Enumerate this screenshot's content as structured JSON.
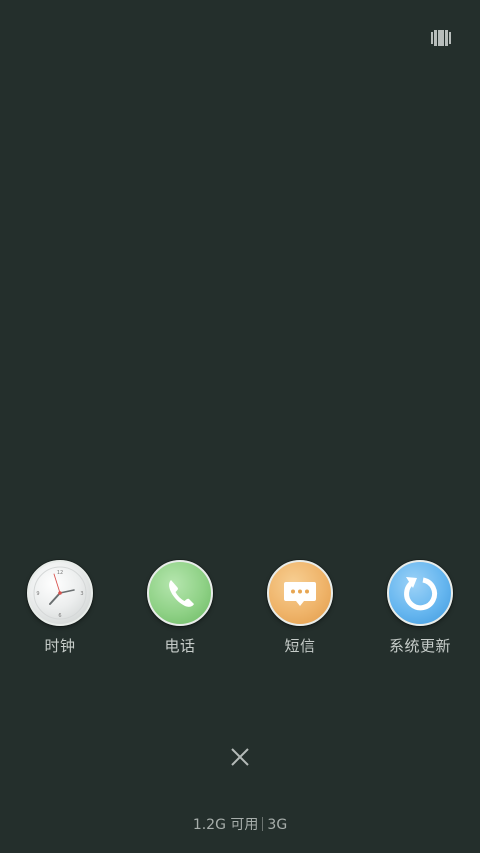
{
  "top_bar": {
    "recent_apps_icon": "recent-apps-icon"
  },
  "apps": [
    {
      "label": "时钟",
      "icon": "clock-icon",
      "color": "#e9ecec"
    },
    {
      "label": "电话",
      "icon": "phone-icon",
      "color": "#8fd186"
    },
    {
      "label": "短信",
      "icon": "message-icon",
      "color": "#efb46a"
    },
    {
      "label": "系统更新",
      "icon": "update-icon",
      "color": "#66b6ef"
    }
  ],
  "clock": {
    "num_12": "12",
    "num_3": "3",
    "num_6": "6",
    "num_9": "9"
  },
  "bottom": {
    "close_icon": "close-icon",
    "memory": "1.2G 可用",
    "total": "3G"
  },
  "colors": {
    "background": "#242f2c",
    "label_text": "#c6ccc9"
  }
}
